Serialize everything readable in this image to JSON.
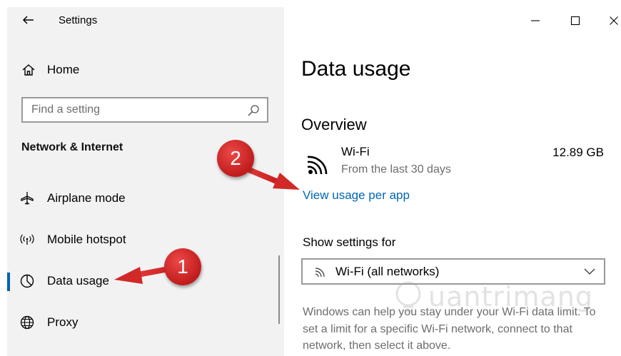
{
  "window": {
    "title": "Settings",
    "controls": {
      "minimize": "minimize-icon",
      "maximize": "maximize-icon",
      "close": "close-icon"
    }
  },
  "sidebar": {
    "home_label": "Home",
    "search_placeholder": "Find a setting",
    "section_title": "Network & Internet",
    "items": [
      {
        "label": "Airplane mode",
        "icon": "airplane-icon",
        "selected": false
      },
      {
        "label": "Mobile hotspot",
        "icon": "hotspot-icon",
        "selected": false
      },
      {
        "label": "Data usage",
        "icon": "data-usage-icon",
        "selected": true
      },
      {
        "label": "Proxy",
        "icon": "globe-icon",
        "selected": false
      }
    ]
  },
  "main": {
    "page_title": "Data usage",
    "overview_title": "Overview",
    "network": {
      "name": "Wi-Fi",
      "subtitle": "From the last 30 days",
      "usage": "12.89 GB"
    },
    "view_usage_link": "View usage per app",
    "show_settings_label": "Show settings for",
    "dropdown_value": "Wi-Fi (all networks)",
    "description": "Windows can help you stay under your Wi-Fi data limit. To set a limit for a specific Wi-Fi network, connect to that network, then select it above."
  },
  "annotations": {
    "callout_1": "1",
    "callout_2": "2",
    "watermark": "uantrimang"
  },
  "colors": {
    "accent": "#0063b1",
    "link": "#0066b4",
    "callout": "#d42a2a",
    "sidebar_bg": "#f2f2f2"
  }
}
